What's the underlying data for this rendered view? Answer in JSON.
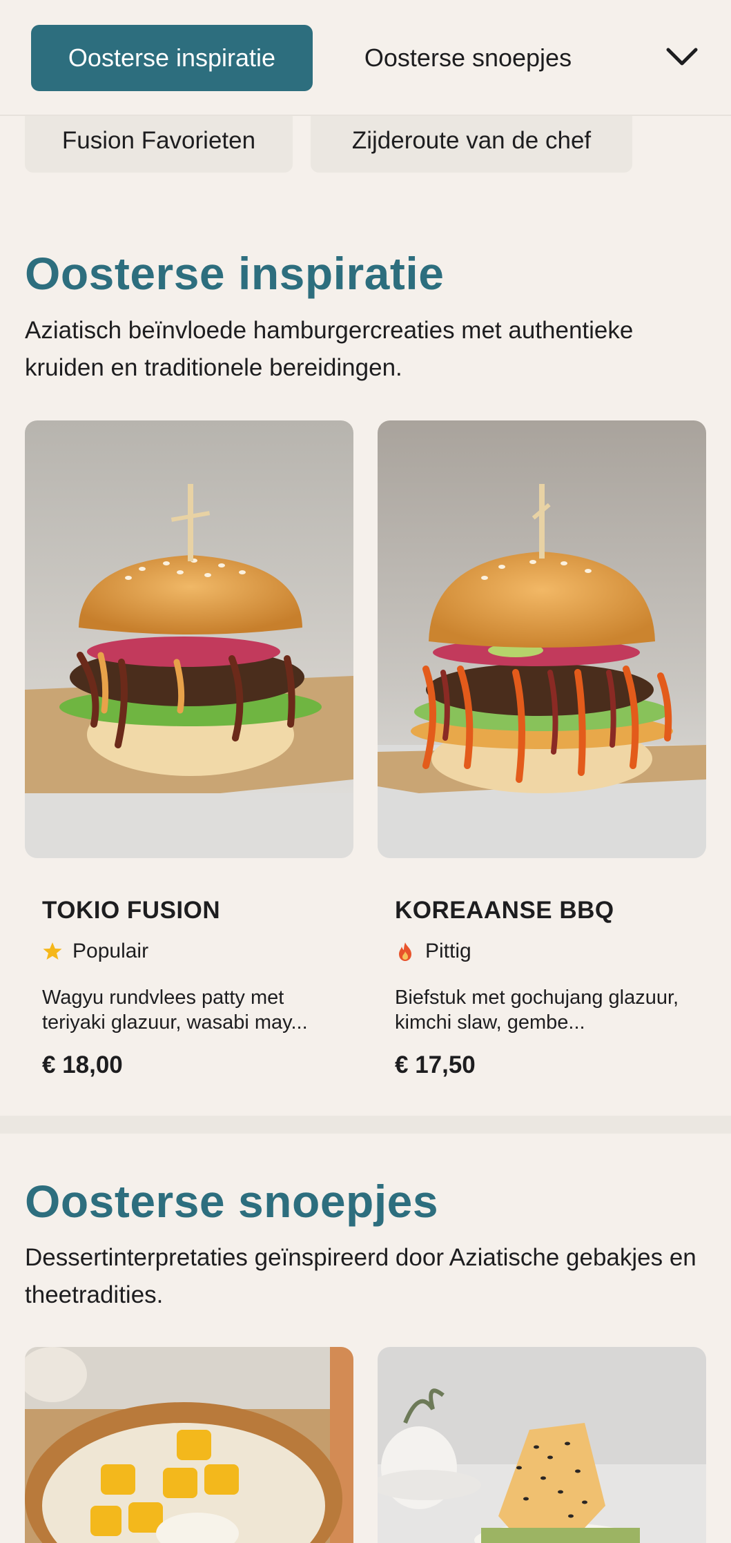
{
  "tabs": {
    "active_label": "Oosterse inspiratie",
    "next_label": "Oosterse snoepjes",
    "chevron_icon": "chevron-down-icon",
    "pills": [
      "Fusion Favorieten",
      "Zijderoute van de chef"
    ]
  },
  "sections": [
    {
      "title": "Oosterse inspiratie",
      "description": "Aziatisch beïnvloede hamburgercreaties met authentieke kruiden en traditionele bereidingen.",
      "items": [
        {
          "name": "TOKIO FUSION",
          "tag": "Populair",
          "tag_icon": "star-icon",
          "description": "Wagyu rundvlees patty met teriyaki glazuur, wasabi may...",
          "price": "€ 18,00"
        },
        {
          "name": "KOREAANSE BBQ",
          "tag": "Pittig",
          "tag_icon": "flame-icon",
          "description": "Biefstuk met gochujang glazuur, kimchi slaw, gembe...",
          "price": "€ 17,50"
        }
      ]
    },
    {
      "title": "Oosterse snoepjes",
      "description": "Dessertinterpretaties geïnspireerd door Aziatische gebakjes en theetradities."
    }
  ],
  "colors": {
    "accent": "#2d6e7e",
    "background": "#f5f0eb",
    "pill": "#ebe7e1",
    "star": "#f5b71a",
    "flame": "#e8532b"
  }
}
